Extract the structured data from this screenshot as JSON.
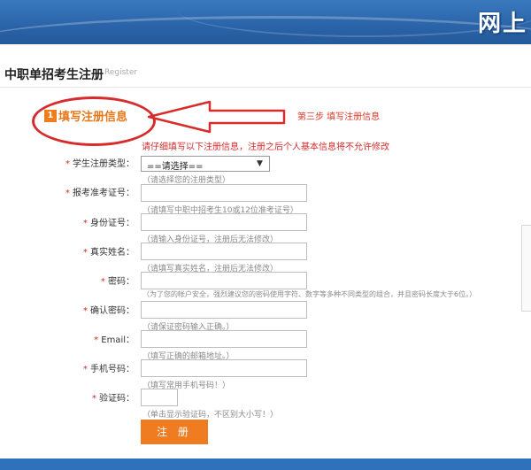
{
  "header": {
    "banner_text": "网上"
  },
  "page": {
    "title": "中职单招考生注册",
    "subtitle": "Register"
  },
  "step": {
    "number": "1",
    "title": "填写注册信息",
    "right_text": "第三步  填写注册信息"
  },
  "notice": "请仔细填写以下注册信息，注册之后个人基本信息将不允许修改",
  "form": {
    "fields": [
      {
        "required": "*",
        "label": "学生注册类型：",
        "type": "select",
        "value": "==请选择==",
        "hint": "（请选择您的注册类型）"
      },
      {
        "required": "*",
        "label": "报考准考证号：",
        "type": "text",
        "value": "",
        "hint": "（请填写中职中招考生10或12位准考证号）"
      },
      {
        "required": "*",
        "label": "身份证号：",
        "type": "text",
        "value": "",
        "hint": "（请输入身份证号，注册后无法修改）"
      },
      {
        "required": "*",
        "label": "真实姓名：",
        "type": "text",
        "value": "",
        "hint": "（请填写真实姓名，注册后无法修改）"
      },
      {
        "required": "*",
        "label": "密码：",
        "type": "password",
        "value": "",
        "hint": "（为了您的帐户安全，强烈建议您的密码使用字符、数字等多种不同类型的组合，并且密码长度大于6位。）"
      },
      {
        "required": "*",
        "label": "确认密码：",
        "type": "password",
        "value": "",
        "hint": "（请保证密码输入正确。）"
      },
      {
        "required": "*",
        "label": "Email：",
        "type": "text",
        "value": "",
        "hint": "（填写正确的邮箱地址。）"
      },
      {
        "required": "*",
        "label": "手机号码：",
        "type": "text",
        "value": "",
        "hint": "（填写常用手机号码！）"
      },
      {
        "required": "*",
        "label": "验证码：",
        "type": "captcha",
        "value": "",
        "hint": "（单击显示验证码，不区别大小写！）"
      }
    ],
    "submit_label": "注 册"
  },
  "colors": {
    "banner": "#2a63a8",
    "accent_orange": "#f07c22",
    "alert_red": "#d32b2b",
    "annotation_red": "#d62c2c"
  }
}
